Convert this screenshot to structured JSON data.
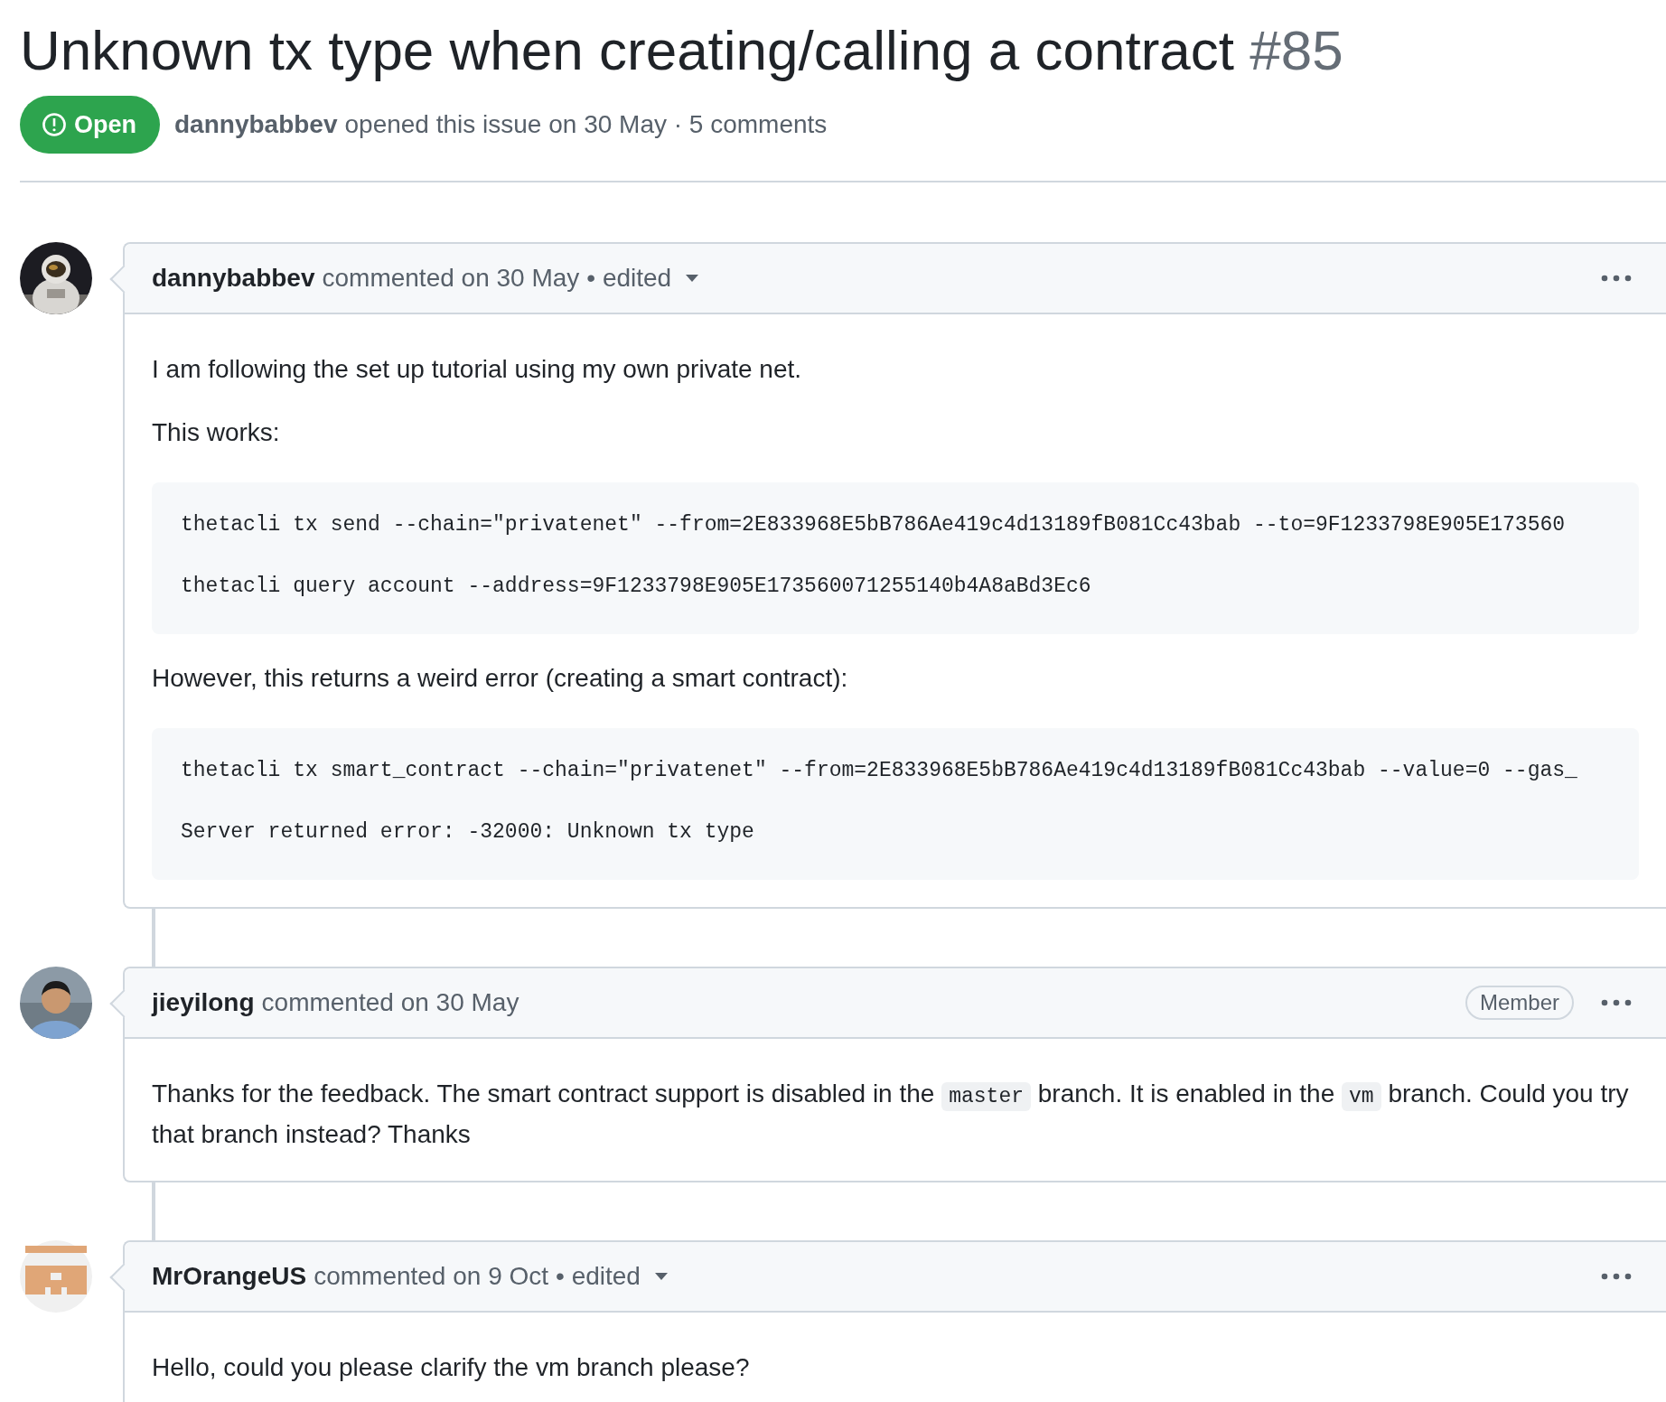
{
  "issue": {
    "title": "Unknown tx type when creating/calling a contract",
    "number": "#85",
    "status": {
      "label": "Open",
      "kind": "open"
    },
    "author": "dannybabbev",
    "summary": "opened this issue on 30 May · 5 comments"
  },
  "comments": [
    {
      "author": "dannybabbev",
      "meta": "commented on 30 May",
      "edited_label": "• edited",
      "avatar": {
        "kind": "picture"
      },
      "blocks": [
        {
          "kind": "paragraph",
          "segments": [
            {
              "kind": "text",
              "text": "I am following the set up tutorial using my own private net."
            }
          ]
        },
        {
          "kind": "paragraph",
          "segments": [
            {
              "kind": "text",
              "text": "This works:"
            }
          ]
        },
        {
          "kind": "code",
          "lines": [
            "thetacli tx send --chain=\"privatenet\" --from=2E833968E5bB786Ae419c4d13189fB081Cc43bab --to=9F1233798E905E173560",
            "thetacli query account --address=9F1233798E905E173560071255140b4A8aBd3Ec6"
          ]
        },
        {
          "kind": "paragraph",
          "segments": [
            {
              "kind": "text",
              "text": "However, this returns a weird error (creating a smart contract):"
            }
          ]
        },
        {
          "kind": "code",
          "lines": [
            "thetacli tx smart_contract --chain=\"privatenet\" --from=2E833968E5bB786Ae419c4d13189fB081Cc43bab --value=0 --gas_",
            "Server returned error: -32000: Unknown tx type"
          ]
        }
      ]
    },
    {
      "author": "jieyilong",
      "meta": "commented on 30 May",
      "role": "Member",
      "avatar": {
        "kind": "picture"
      },
      "blocks": [
        {
          "kind": "paragraph",
          "segments": [
            {
              "kind": "text",
              "text": "Thanks for the feedback. The smart contract support is disabled in the "
            },
            {
              "kind": "code",
              "text": "master"
            },
            {
              "kind": "text",
              "text": " branch. It is enabled in the "
            },
            {
              "kind": "code",
              "text": "vm"
            },
            {
              "kind": "text",
              "text": " branch. Could you try that branch instead? Thanks"
            }
          ]
        }
      ]
    },
    {
      "author": "MrOrangeUS",
      "meta": "commented on 9 Oct",
      "edited_label": "• edited",
      "avatar": {
        "kind": "identicon"
      },
      "blocks": [
        {
          "kind": "paragraph",
          "segments": [
            {
              "kind": "text",
              "text": "Hello, could you please clarify the vm branch please?"
            }
          ]
        }
      ]
    }
  ]
}
